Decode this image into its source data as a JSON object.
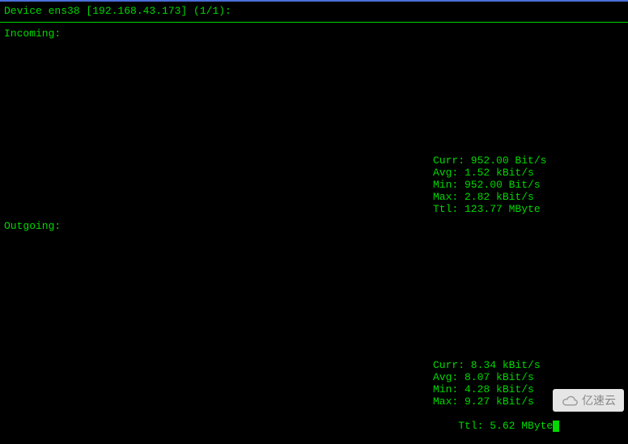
{
  "header": {
    "title": "Device ens38 [192.168.43.173] (1/1):"
  },
  "sections": {
    "incoming_label": "Incoming:",
    "outgoing_label": "Outgoing:"
  },
  "incoming_stats": {
    "curr": "Curr: 952.00 Bit/s",
    "avg": "Avg: 1.52 kBit/s",
    "min": "Min: 952.00 Bit/s",
    "max": "Max: 2.82 kBit/s",
    "ttl": "Ttl: 123.77 MByte"
  },
  "outgoing_stats": {
    "curr": "Curr: 8.34 kBit/s",
    "avg": "Avg: 8.07 kBit/s",
    "min": "Min: 4.28 kBit/s",
    "max": "Max: 9.27 kBit/s",
    "ttl": "Ttl: 5.62 MByte"
  },
  "watermark": {
    "text": "亿速云"
  },
  "chart_data": [
    {
      "type": "area",
      "title": "Incoming",
      "series": [
        {
          "name": "Curr",
          "value": 952.0,
          "unit": "Bit/s"
        },
        {
          "name": "Avg",
          "value": 1.52,
          "unit": "kBit/s"
        },
        {
          "name": "Min",
          "value": 952.0,
          "unit": "Bit/s"
        },
        {
          "name": "Max",
          "value": 2.82,
          "unit": "kBit/s"
        },
        {
          "name": "Ttl",
          "value": 123.77,
          "unit": "MByte"
        }
      ]
    },
    {
      "type": "area",
      "title": "Outgoing",
      "series": [
        {
          "name": "Curr",
          "value": 8.34,
          "unit": "kBit/s"
        },
        {
          "name": "Avg",
          "value": 8.07,
          "unit": "kBit/s"
        },
        {
          "name": "Min",
          "value": 4.28,
          "unit": "kBit/s"
        },
        {
          "name": "Max",
          "value": 9.27,
          "unit": "kBit/s"
        },
        {
          "name": "Ttl",
          "value": 5.62,
          "unit": "MByte"
        }
      ]
    }
  ]
}
